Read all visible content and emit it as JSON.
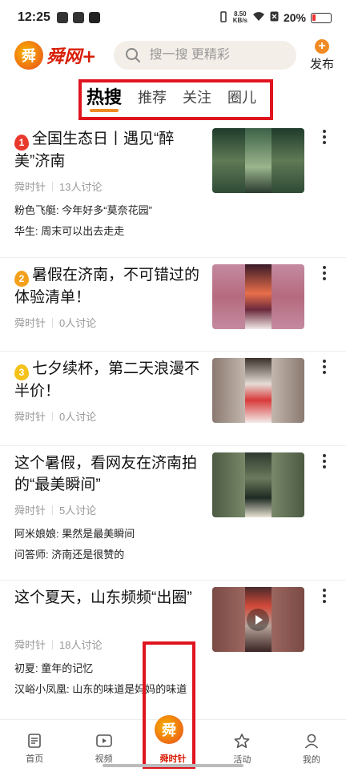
{
  "status_bar": {
    "time": "12:25",
    "net_speed_value": "8.50",
    "net_speed_unit": "KB/s",
    "battery": "20%"
  },
  "header": {
    "logo_char": "舜",
    "logo_text": "舜网+",
    "search_placeholder": "搜一搜 更精彩",
    "publish_label": "发布"
  },
  "tabs": [
    {
      "label": "热搜",
      "active": true
    },
    {
      "label": "推荐",
      "active": false
    },
    {
      "label": "关注",
      "active": false
    },
    {
      "label": "圈儿",
      "active": false
    }
  ],
  "feed": [
    {
      "rank": "1",
      "title": "全国生态日丨遇见“醉美”济南",
      "source": "舜时针",
      "discussions": "13人讨论",
      "comments": [
        {
          "user": "粉色飞艇",
          "text": "今年好多“莫奈花园”"
        },
        {
          "user": "华生",
          "text": "周末可以出去走走"
        }
      ],
      "thumb_colors": [
        "#2f4a36",
        "#5f7a55",
        "#9bb58c"
      ]
    },
    {
      "rank": "2",
      "title": "暑假在济南，不可错过的体验清单！",
      "source": "舜时针",
      "discussions": "0人讨论",
      "comments": [],
      "thumb_colors": [
        "#c48aa0",
        "#6c2a3e",
        "#e86f4a"
      ]
    },
    {
      "rank": "3",
      "title": "七夕续杯，第二天浪漫不半价！",
      "source": "舜时针",
      "discussions": "0人讨论",
      "comments": [],
      "thumb_colors": [
        "#bca99a",
        "#e6dcd6",
        "#d83a3a"
      ]
    },
    {
      "rank": "",
      "title": "这个暑假，看网友在济南拍的“最美瞬间”",
      "source": "舜时针",
      "discussions": "5人讨论",
      "comments": [
        {
          "user": "阿米娘娘",
          "text": "果然是最美瞬间"
        },
        {
          "user": "问答师",
          "text": "济南还是很赞的"
        }
      ],
      "thumb_colors": [
        "#6b7a5c",
        "#2d3a2e",
        "#e8e3d3"
      ]
    },
    {
      "rank": "",
      "title": "这个夏天，山东频频“出圈”",
      "source": "舜时针",
      "discussions": "18人讨论",
      "comments": [
        {
          "user": "初夏",
          "text": "童年的记忆"
        },
        {
          "user": "汉峪小凤凰",
          "text": "山东的味道是妈妈的味道"
        }
      ],
      "thumb_colors": [
        "#a8716a",
        "#4a2a2a",
        "#d24a3a"
      ]
    }
  ],
  "bottom_nav": [
    {
      "label": "首页",
      "icon": "news-icon",
      "active": false
    },
    {
      "label": "视频",
      "icon": "video-icon",
      "active": false
    },
    {
      "label": "舜时针",
      "icon": "shun-logo-icon",
      "active": true
    },
    {
      "label": "活动",
      "icon": "star-icon",
      "active": false
    },
    {
      "label": "我的",
      "icon": "user-icon",
      "active": false
    }
  ],
  "colors": {
    "accent_red": "#d81e06",
    "highlight_frame": "#e0141e",
    "tab_underline": "#f08a24"
  }
}
